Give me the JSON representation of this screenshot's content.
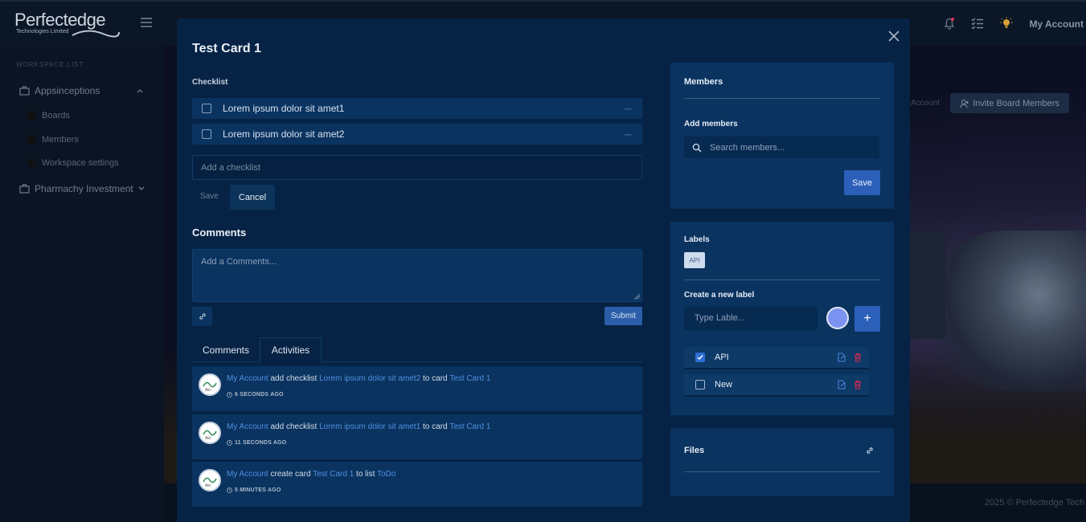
{
  "app": {
    "logo_name": "Perfectedge",
    "logo_sub": "Technologies Limited",
    "account": "My Account",
    "copyright": "2025 © Perfectedge Tech"
  },
  "sidebar": {
    "section_label": "WORKSPACE LIST",
    "workspaces": [
      {
        "label": "Appsinceptions"
      },
      {
        "label": "Pharmachy Investment"
      }
    ],
    "sub_items": [
      {
        "label": "Boards"
      },
      {
        "label": "Members"
      },
      {
        "label": "Workspace settings"
      }
    ]
  },
  "board": {
    "invite_label": "Invite Board Members",
    "ghost_text": "Account"
  },
  "modal": {
    "title": "Test Card 1",
    "checklist": {
      "label": "Checklist",
      "items": [
        {
          "text": "Lorem ipsum dolor sit amet1",
          "checked": false
        },
        {
          "text": "Lorem ipsum dolor sit amet2",
          "checked": false
        }
      ],
      "more_icon": "···",
      "input_placeholder": "Add a checklist",
      "save_label": "Save",
      "cancel_label": "Cancel"
    },
    "comments": {
      "heading": "Comments",
      "placeholder": "Add a Comments...",
      "submit_label": "Submit"
    },
    "tabs": [
      {
        "label": "Comments",
        "active": false
      },
      {
        "label": "Activities",
        "active": true
      }
    ],
    "activities": [
      {
        "user": "My Account",
        "action": "add checklist",
        "object": "Lorem ipsum dolor sit amet2",
        "connector": "to card",
        "target": "Test Card 1",
        "time": "6 SECONDS AGO"
      },
      {
        "user": "My Account",
        "action": "add checklist",
        "object": "Lorem ipsum dolor sit amet1",
        "connector": "to card",
        "target": "Test Card 1",
        "time": "11 SECONDS AGO"
      },
      {
        "user": "My Account",
        "action": "create card",
        "object": "Test Card 1",
        "connector": "to list",
        "target": "ToDo",
        "time": "5 MINUTES AGO"
      }
    ],
    "members": {
      "title": "Members",
      "add_label": "Add members",
      "search_placeholder": "Search members...",
      "save_label": "Save"
    },
    "labels": {
      "title": "Labels",
      "chip": "API",
      "create_label": "Create a new label",
      "input_placeholder": "Type Lable...",
      "add_symbol": "+",
      "selected_color": "#7b93f0",
      "items": [
        {
          "text": "API",
          "checked": true
        },
        {
          "text": "New",
          "checked": false
        }
      ]
    },
    "files": {
      "title": "Files"
    }
  },
  "colors": {
    "modal_bg": "#062345",
    "panel_bg": "#0a3360",
    "accent": "#2b5fb8",
    "link": "#4f8fe0",
    "danger": "#e0284f"
  }
}
